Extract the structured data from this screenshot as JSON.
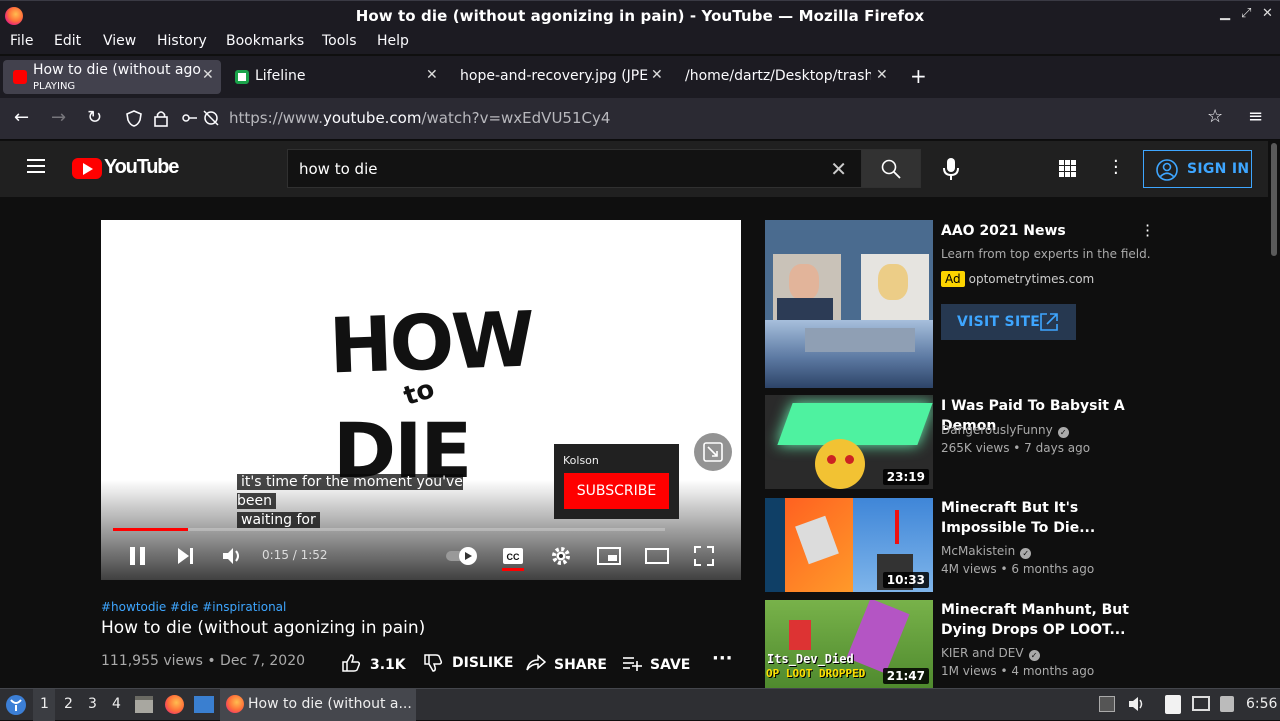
{
  "window": {
    "title": "How to die (without agonizing in pain) - YouTube — Mozilla Firefox"
  },
  "menu": [
    "File",
    "Edit",
    "View",
    "History",
    "Bookmarks",
    "Tools",
    "Help"
  ],
  "tabs": [
    {
      "label": "How to die (without agonizing in pain) - YouTube",
      "sublabel": "PLAYING",
      "active": true
    },
    {
      "label": "Lifeline",
      "active": false
    },
    {
      "label": "hope-and-recovery.jpg (JPEG Image)",
      "active": false
    },
    {
      "label": "/home/dartz/Desktop/trash-can",
      "active": false
    }
  ],
  "nav": {
    "url_prefix": "https://www.",
    "url_domain": "youtube.com",
    "url_path": "/watch?v=wxEdVU51Cy4"
  },
  "yt": {
    "logo_text": "YouTube",
    "search_value": "how to die",
    "sign_in": "SIGN IN"
  },
  "player": {
    "caption_line1": "it's time for the moment you've been",
    "caption_line2": "waiting for",
    "channel": "Kolson",
    "subscribe": "SUBSCRIBE",
    "time": "0:15 / 1:52",
    "progress": 0.135,
    "art_how": "HOW",
    "art_to": "to",
    "art_die": "DIE"
  },
  "video": {
    "tags": "#howtodie #die #inspirational",
    "title": "How to die (without agonizing in pain)",
    "views_date": "111,955 views • Dec 7, 2020",
    "likes": "3.1K",
    "dislike": "DISLIKE",
    "share": "SHARE",
    "save": "SAVE"
  },
  "ad": {
    "title": "AAO 2021 News",
    "desc": "Learn from top experts in the field.",
    "badge": "Ad",
    "domain": "optometrytimes.com",
    "cta": "VISIT SITE"
  },
  "related": [
    {
      "title": "I Was Paid To Babysit A Demon",
      "channel": "DangerouslyFunny",
      "meta": "265K views • 7 days ago",
      "duration": "23:19"
    },
    {
      "title": "Minecraft But It's Impossible To Die...",
      "channel": "McMakistein",
      "meta": "4M views • 6 months ago",
      "duration": "10:33"
    },
    {
      "title": "Minecraft Manhunt, But Dying Drops OP LOOT...",
      "channel": "KIER and DEV",
      "meta": "1M views • 4 months ago",
      "duration": "21:47",
      "thumb_text1": "Its_Dev_Died",
      "thumb_text2": "OP LOOT DROPPED"
    }
  ],
  "taskbar": {
    "workspaces": [
      "1",
      "2",
      "3",
      "4"
    ],
    "window_label": "How to die (without a...",
    "clock": "6:56"
  }
}
